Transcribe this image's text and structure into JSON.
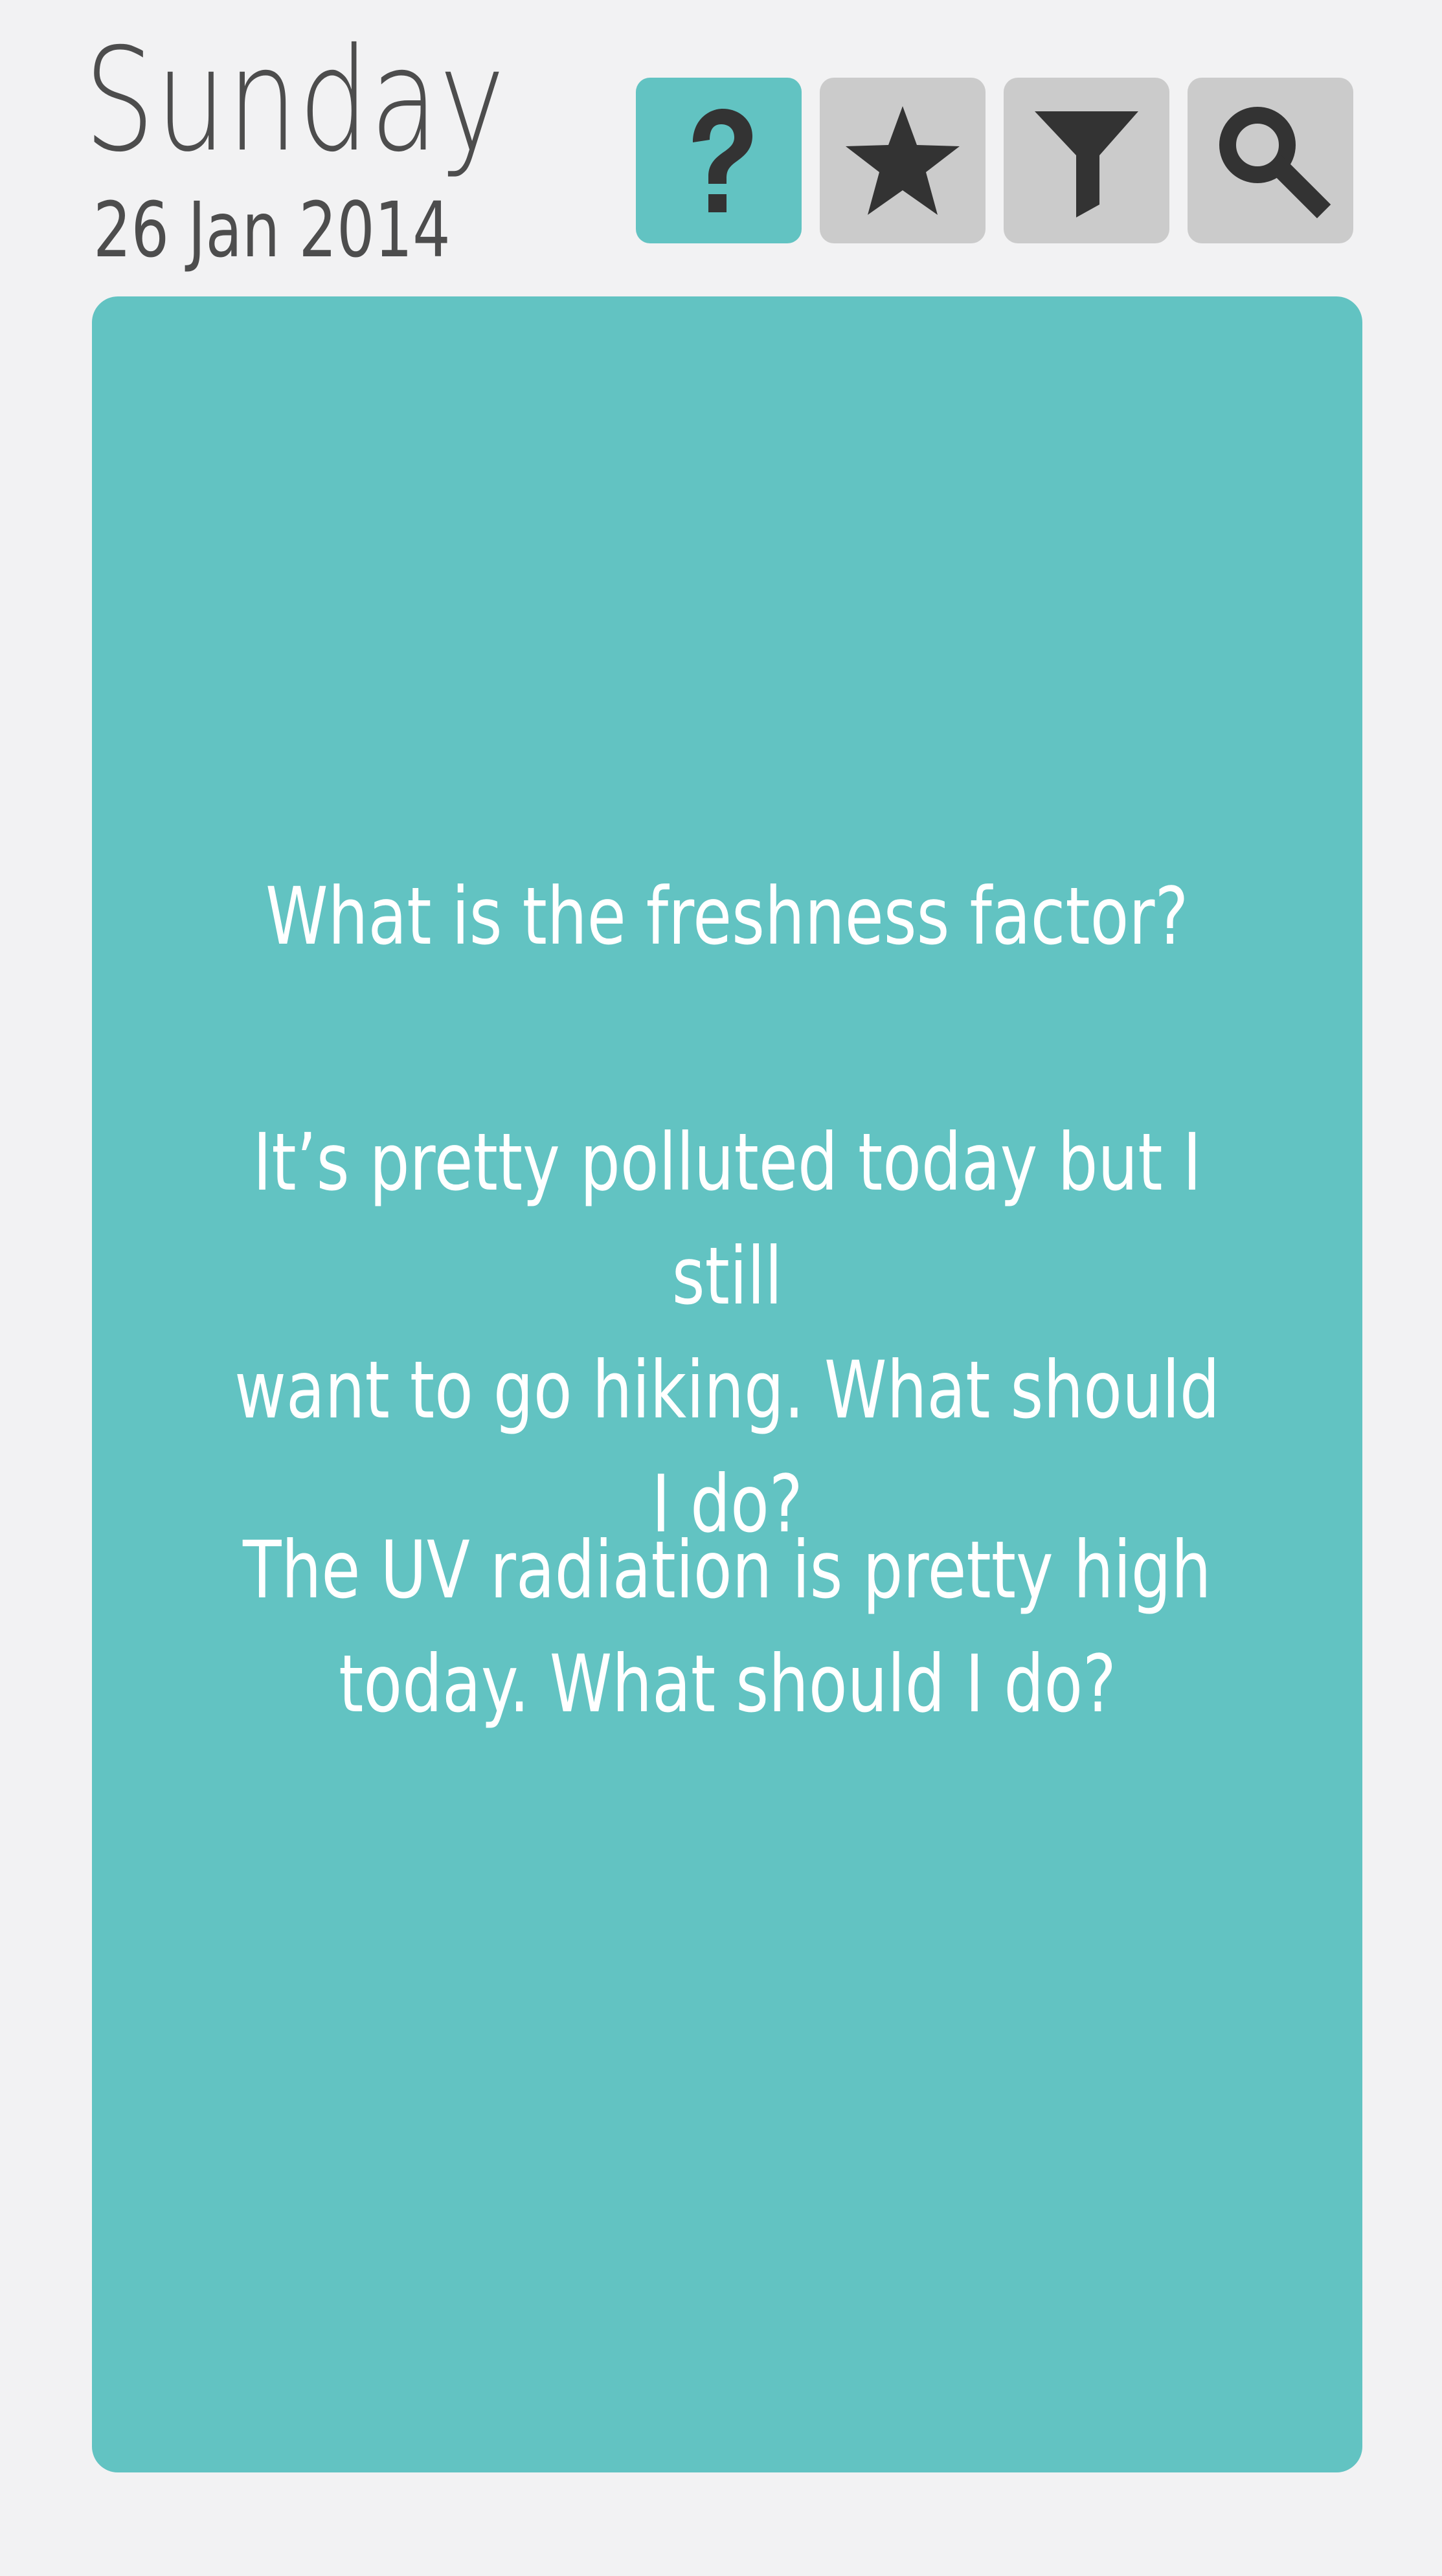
{
  "header": {
    "day": "Sunday",
    "date": "26 Jan 2014"
  },
  "toolbar": {
    "buttons": [
      {
        "icon": "question-mark-icon",
        "active": true
      },
      {
        "icon": "star-icon",
        "active": false
      },
      {
        "icon": "filter-funnel-icon",
        "active": false
      },
      {
        "icon": "search-icon",
        "active": false
      }
    ]
  },
  "card": {
    "questions": [
      {
        "line1": "What is the freshness factor?",
        "line2": ""
      },
      {
        "line1": "It’s pretty polluted today but I still",
        "line2": "want to go hiking. What should I do?"
      },
      {
        "line1": "The UV radiation is pretty high",
        "line2": "today. What should I do?"
      }
    ]
  },
  "colors": {
    "accent": "#62c3c2",
    "button_inactive": "#cbcbcb",
    "background": "#f2f2f3",
    "icon": "#333333",
    "text_dark": "#4d4d4d",
    "text_light": "#ffffff"
  }
}
